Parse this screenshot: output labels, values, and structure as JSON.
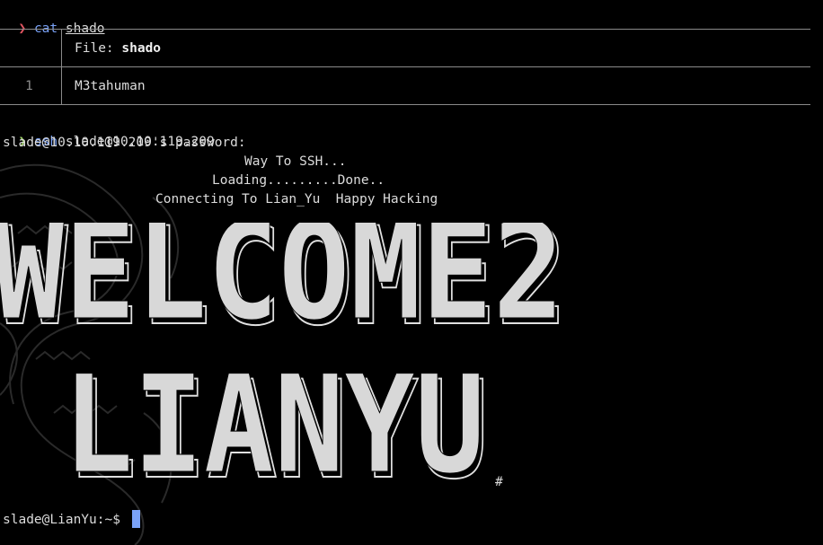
{
  "commands": [
    {
      "arrow": "❯",
      "arrow_color": "#e05561",
      "cmd": "cat",
      "arg": "shado"
    },
    {
      "arrow": "❯",
      "arrow_color": "#9ece6a",
      "cmd": "ssh",
      "arg": "slade@10.10.119.209"
    }
  ],
  "bat": {
    "file_label": "File: ",
    "file_name": "shado",
    "line_number": "1",
    "line_content": "M3tahuman"
  },
  "ssh": {
    "password_prompt": "slade@10.10.119.209's password:",
    "motd_line1": "Way To SSH...",
    "motd_line2": "Loading.........Done..",
    "motd_line3": "Connecting To Lian_Yu  Happy Hacking"
  },
  "banner": {
    "line1": "WELCOME2",
    "line2": "LIANYU",
    "trailing": "#",
    "color": "#e0e0e0"
  },
  "shell_prompt": "slade@LianYu:~$",
  "colors": {
    "background": "#000000",
    "text": "#dcdcdc",
    "command": "#7aa2f7",
    "cursor": "#7aa2f7",
    "table_border": "#8a8a8a"
  }
}
